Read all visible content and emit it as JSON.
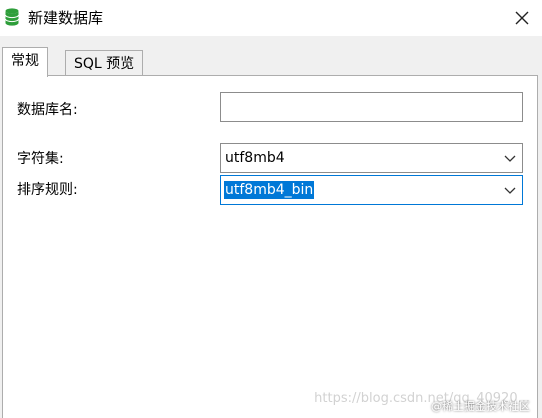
{
  "window": {
    "title": "新建数据库",
    "close_icon": "close-icon",
    "app_icon": "database-icon"
  },
  "tabs": [
    {
      "label": "常规",
      "active": true
    },
    {
      "label": "SQL 预览",
      "active": false
    }
  ],
  "form": {
    "db_name_label": "数据库名:",
    "db_name_value": "",
    "charset_label": "字符集:",
    "charset_value": "utf8mb4",
    "collation_label": "排序规则:",
    "collation_value": "utf8mb4_bin"
  },
  "watermark": {
    "url": "https://blog.csdn.net/qq_40920...",
    "brand": "@稀土掘金技术社区"
  },
  "colors": {
    "accent": "#0078d7",
    "db_icon": "#2e9e3a"
  }
}
